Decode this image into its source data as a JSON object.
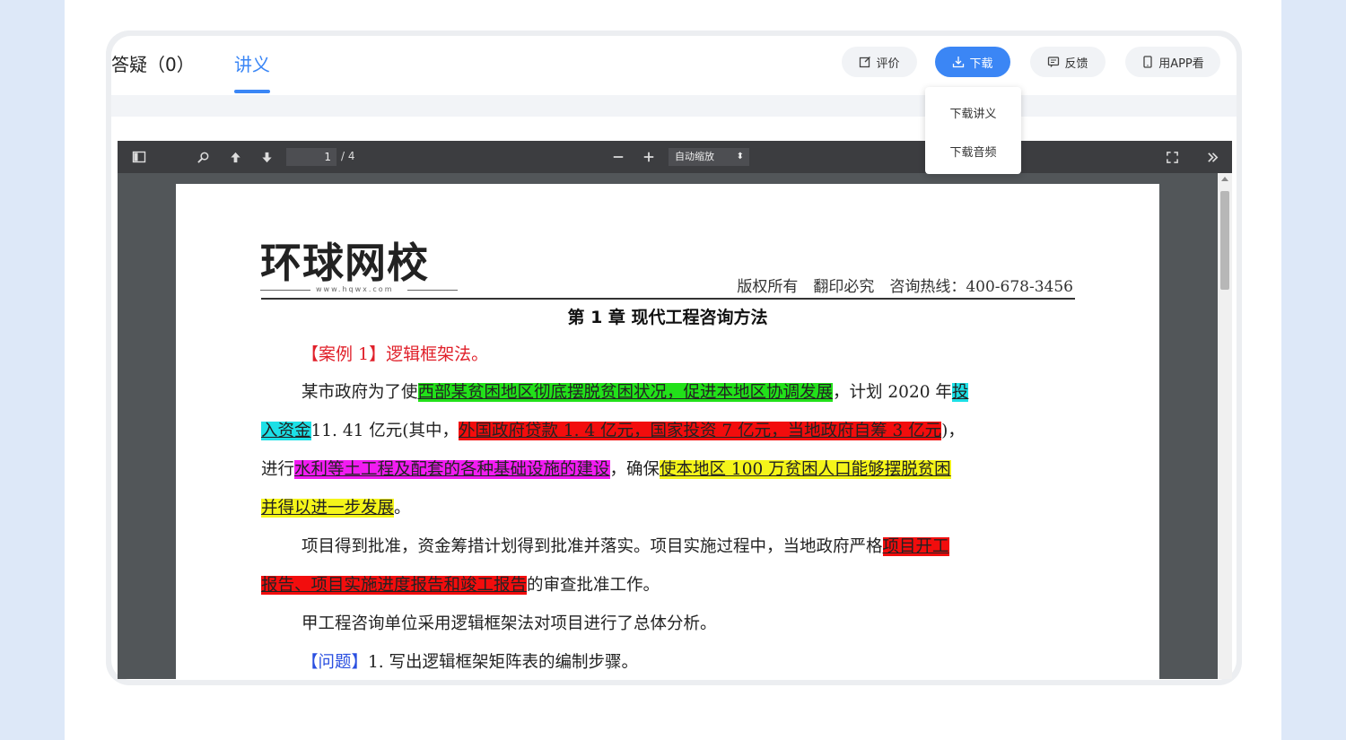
{
  "tabs": {
    "qa_label": "答疑（0）",
    "notes_label": "讲义"
  },
  "actions": {
    "review_label": "评价",
    "download_label": "下载",
    "feedback_label": "反馈",
    "app_label": "用APP看"
  },
  "download_menu": {
    "items": [
      "下载讲义",
      "下载音频"
    ]
  },
  "viewer": {
    "current_page": "1",
    "total_pages": "/ 4",
    "zoom_option": "自动缩放"
  },
  "document": {
    "logo_text": "环球网校",
    "logo_url": "www.hqwx.com",
    "copyright": "版权所有　翻印必究　咨询热线：400-678-3456",
    "chapter_title": "第 1 章  现代工程咨询方法",
    "case_heading": "【案例 1】逻辑框架法。",
    "p1_a": "某市政府为了使",
    "p1_hl1": "西部某贫困地区彻底摆脱贫困状况，促进本地区协调发展",
    "p1_b": "，计划 2020 年",
    "p1_hl2": "投",
    "p2_hl1": "入资金",
    "p2_a": "11. 41 亿元(其中，",
    "p2_hl2": "外国政府贷款 1. 4 亿元，国家投资 7 亿元，当地政府自筹 3 亿元",
    "p2_b": ")，",
    "p3_a": "进行",
    "p3_hl1": "水利等土工程及配套的各种基础设施的建设",
    "p3_b": "，确保",
    "p3_hl2": "使本地区 100 万贫困人口能够摆脱贫困",
    "p4_hl": "并得以进一步发展",
    "p4_a": "。",
    "p5_a": "项目得到批准，资金筹措计划得到批准并落实。项目实施过程中，当地政府严格",
    "p5_hl": "项目开工",
    "p6_hl": "报告、项目实施进度报告和竣工报告",
    "p6_a": "的审查批准工作。",
    "p7": "甲工程咨询单位采用逻辑框架法对项目进行了总体分析。",
    "q_label": "【问题】",
    "q_text": "1. 写出逻辑框架矩阵表的编制步骤。"
  },
  "colors": {
    "accent": "#3b86f5",
    "highlight_green": "#22e11a",
    "highlight_cyan": "#1de0e6",
    "highlight_red": "#f20d0d",
    "highlight_magenta": "#f21cf2",
    "highlight_yellow": "#f5f51a"
  }
}
